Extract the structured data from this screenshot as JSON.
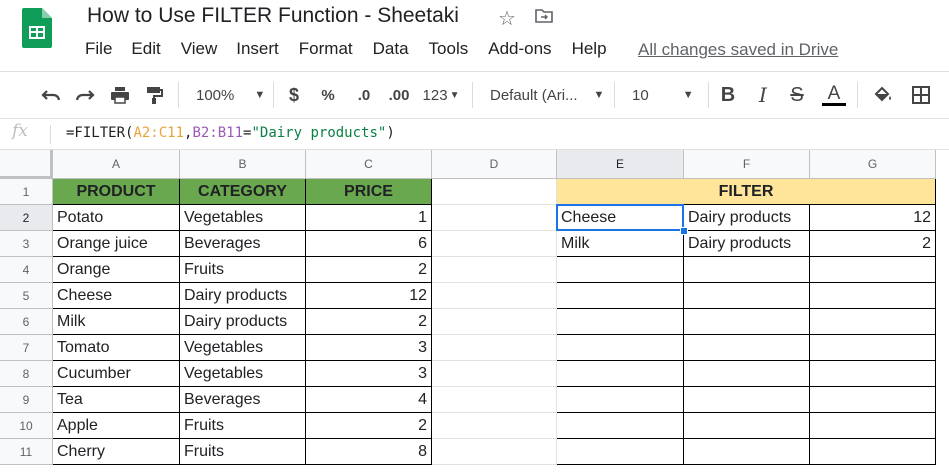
{
  "app": {
    "title": "How to Use FILTER Function - Sheetaki",
    "menu": [
      "File",
      "Edit",
      "View",
      "Insert",
      "Format",
      "Data",
      "Tools",
      "Add-ons",
      "Help"
    ],
    "saved_status": "All changes saved in Drive"
  },
  "toolbar": {
    "zoom": "100%",
    "currency": "$",
    "percent": "%",
    "decrease_decimal": ".0",
    "increase_decimal": ".00",
    "more_formats": "123",
    "font": "Default (Ari...",
    "font_size": "10",
    "bold": "B",
    "italic": "I",
    "strikethrough": "S",
    "text_color": "A"
  },
  "formula_bar": {
    "fx": "fx",
    "prefix": "=FILTER(",
    "range1": "A2:C11",
    "comma": ",",
    "range2": "B2:B11",
    "eq": "=",
    "string": "\"Dairy products\"",
    "suffix": ")"
  },
  "columns": [
    "A",
    "B",
    "C",
    "D",
    "E",
    "F",
    "G"
  ],
  "rows": [
    "1",
    "2",
    "3",
    "4",
    "5",
    "6",
    "7",
    "8",
    "9",
    "10",
    "11"
  ],
  "table": {
    "headers": [
      "PRODUCT",
      "CATEGORY",
      "PRICE"
    ],
    "rows": [
      [
        "Potato",
        "Vegetables",
        "1"
      ],
      [
        "Orange juice",
        "Beverages",
        "6"
      ],
      [
        "Orange",
        "Fruits",
        "2"
      ],
      [
        "Cheese",
        "Dairy products",
        "12"
      ],
      [
        "Milk",
        "Dairy products",
        "2"
      ],
      [
        "Tomato",
        "Vegetables",
        "3"
      ],
      [
        "Cucumber",
        "Vegetables",
        "3"
      ],
      [
        "Tea",
        "Beverages",
        "4"
      ],
      [
        "Apple",
        "Fruits",
        "2"
      ],
      [
        "Cherry",
        "Fruits",
        "8"
      ]
    ]
  },
  "filter": {
    "header": "FILTER",
    "rows": [
      [
        "Cheese",
        "Dairy products",
        "12"
      ],
      [
        "Milk",
        "Dairy products",
        "2"
      ]
    ]
  },
  "colors": {
    "header_green": "#6aa84f",
    "header_yellow": "#ffe599",
    "selection_blue": "#1a73e8"
  }
}
